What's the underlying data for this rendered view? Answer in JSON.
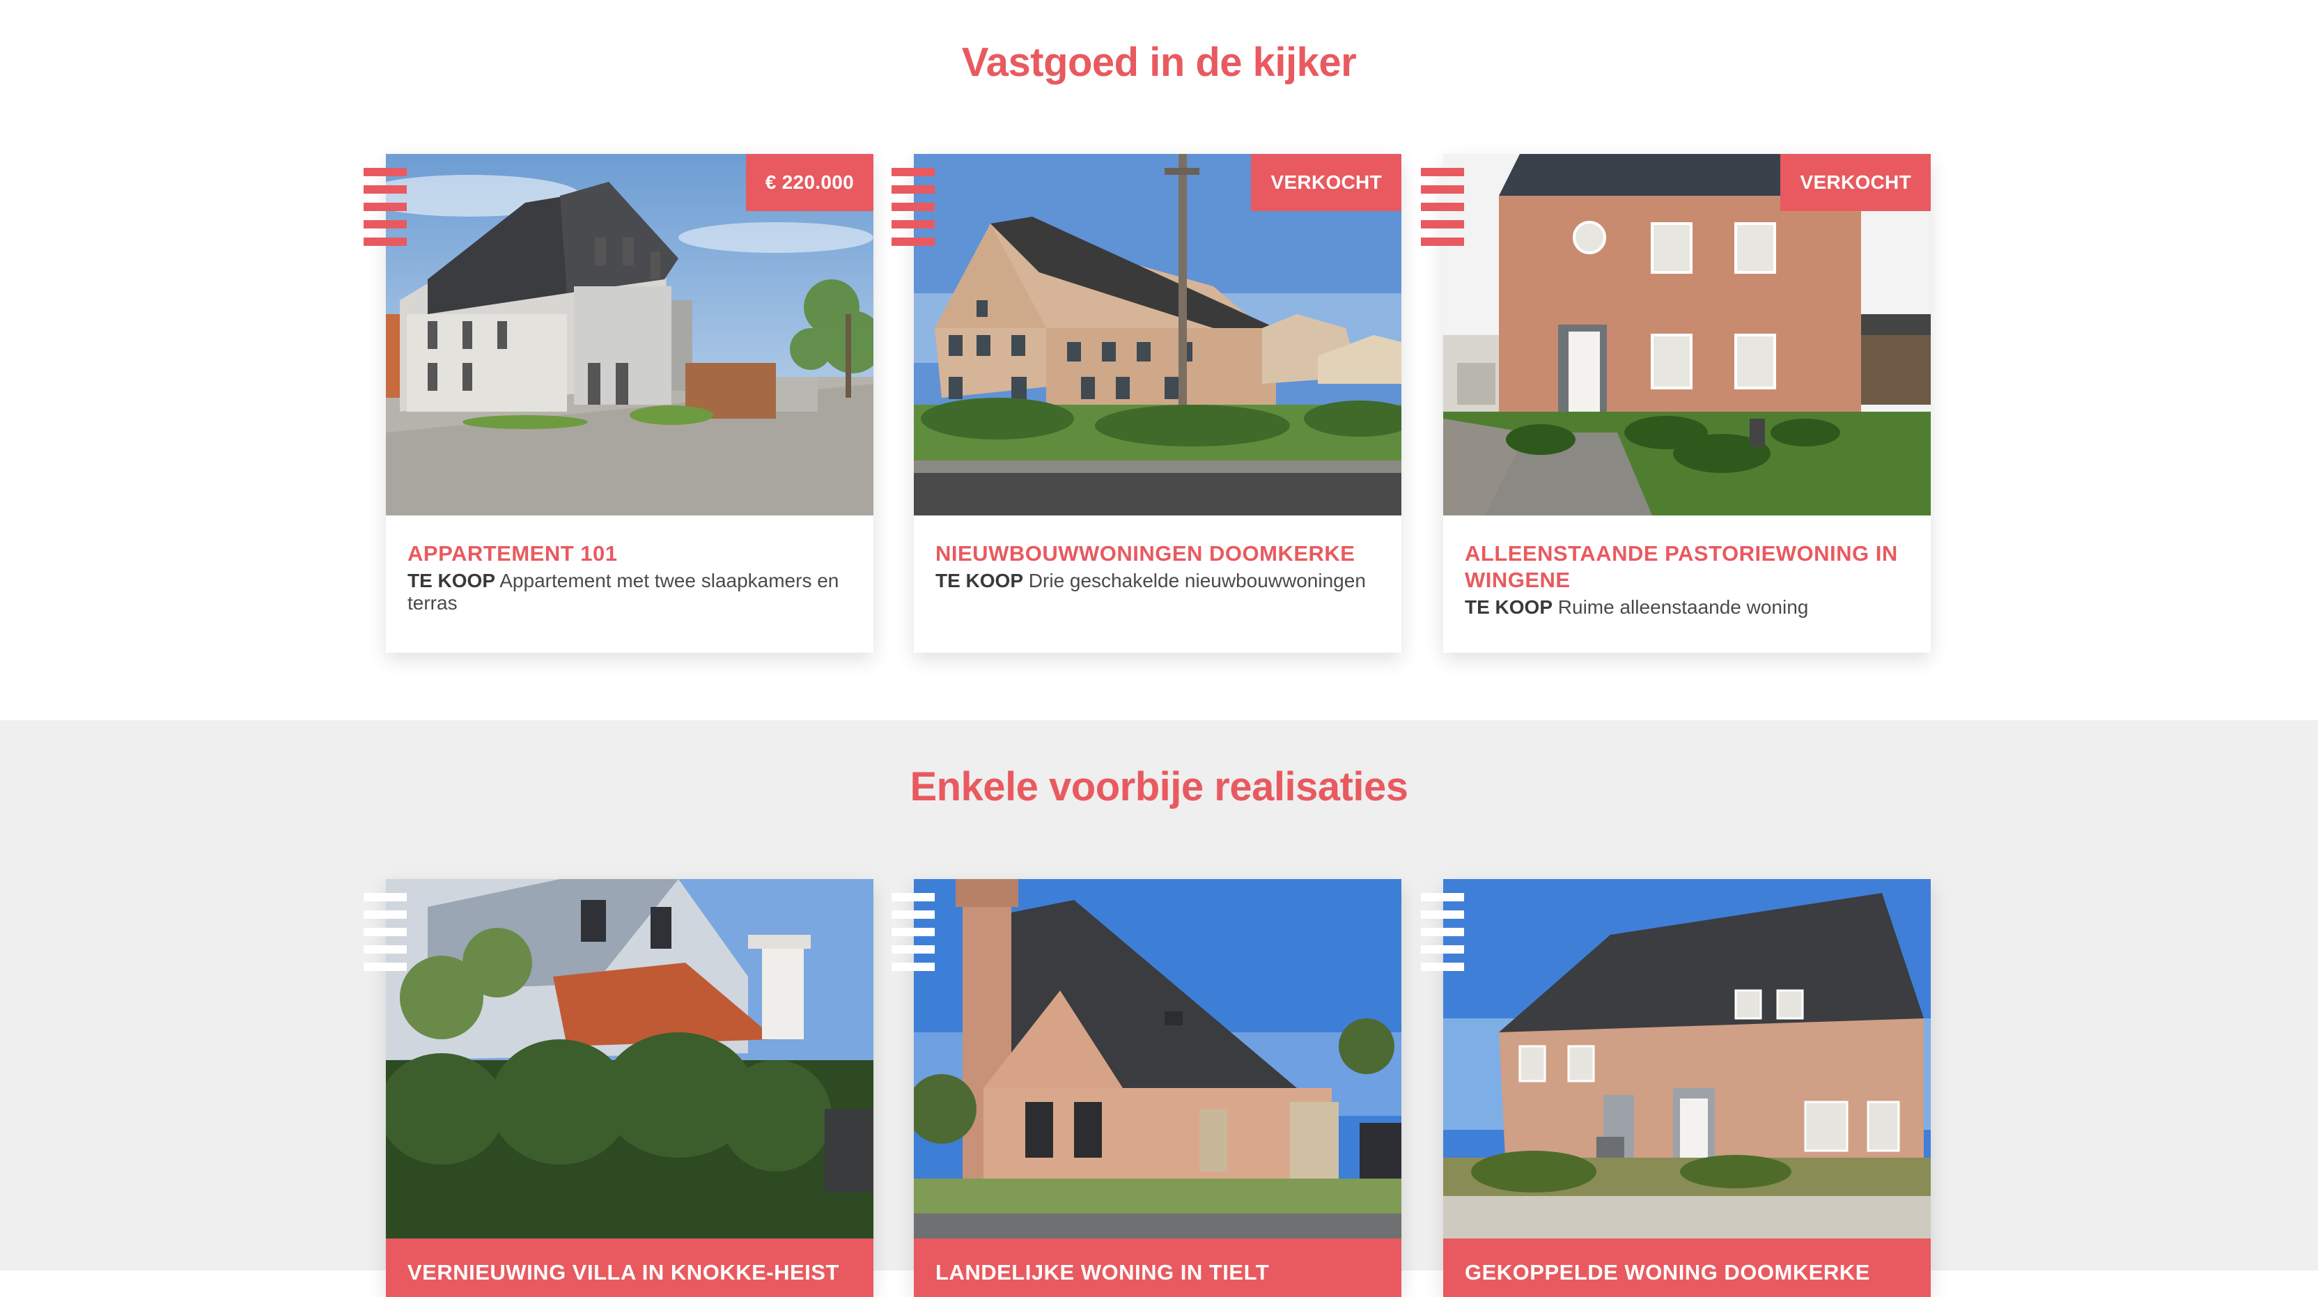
{
  "colors": {
    "accent": "#E85A5F",
    "text": "#3D3D3D",
    "section_bg": "#EFEFEF"
  },
  "featured": {
    "title": "Vastgoed in de kijker",
    "cards": [
      {
        "badge": "€ 220.000",
        "title": "APPARTEMENT 101",
        "status": "TE KOOP",
        "description": "Appartement met twee slaapkamers en terras",
        "photo": "apartment-render"
      },
      {
        "badge": "VERKOCHT",
        "title": "NIEUWBOUWWONINGEN DOOMKERKE",
        "status": "TE KOOP",
        "description": "Drie geschakelde nieuwbouwwoningen",
        "photo": "row-houses"
      },
      {
        "badge": "VERKOCHT",
        "title": "ALLEENSTAANDE PASTORIEWONING IN WINGENE",
        "status": "TE KOOP",
        "description": "Ruime alleenstaande woning",
        "photo": "pastorie-house"
      }
    ]
  },
  "realisations": {
    "title": "Enkele voorbije realisaties",
    "cards": [
      {
        "title": "VERNIEUWING VILLA IN KNOKKE-HEIST",
        "photo": "villa-hedge"
      },
      {
        "title": "LANDELIJKE WONING IN TIELT",
        "photo": "country-house"
      },
      {
        "title": "GEKOPPELDE WONING DOOMKERKE",
        "photo": "semi-detached"
      }
    ]
  }
}
